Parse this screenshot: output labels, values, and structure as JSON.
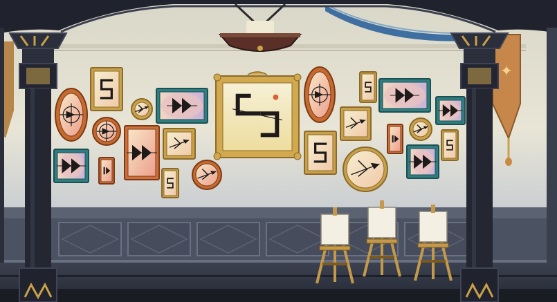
{
  "scene": {
    "wall_color": "#e7e3d3",
    "wainscot_color": "#4b5262",
    "pillar_color": "#232632",
    "gold_color": "#c9a14a",
    "teal_frame_color": "#2f7f82",
    "accent_color": "#e9a07f"
  },
  "frames": [
    {
      "id": "f1",
      "shape": "oval",
      "style": "orange",
      "glyph": "circle-cross"
    },
    {
      "id": "f2",
      "shape": "rect",
      "style": "gold",
      "glyph": "s-rune"
    },
    {
      "id": "f3",
      "shape": "round",
      "style": "gold",
      "glyph": "arrow"
    },
    {
      "id": "f4",
      "shape": "round",
      "style": "orange",
      "glyph": "circle-cross"
    },
    {
      "id": "f5",
      "shape": "rect",
      "style": "teal",
      "glyph": "play-double"
    },
    {
      "id": "f6",
      "shape": "rect",
      "style": "salmon",
      "glyph": "play-double"
    },
    {
      "id": "f7",
      "shape": "rect",
      "style": "gold",
      "glyph": "arrow"
    },
    {
      "id": "f8",
      "shape": "rect",
      "style": "salmon",
      "glyph": "bars"
    },
    {
      "id": "f9",
      "shape": "rect",
      "style": "gold",
      "glyph": "s-rune"
    },
    {
      "id": "f10",
      "shape": "round",
      "style": "orange",
      "glyph": "arrow"
    },
    {
      "id": "f11",
      "shape": "rect",
      "style": "teal",
      "glyph": "play-double"
    },
    {
      "id": "f12",
      "shape": "rect",
      "style": "ornate",
      "glyph": "big-s-rune"
    },
    {
      "id": "f13",
      "shape": "oval",
      "style": "orange",
      "glyph": "circle-cross"
    },
    {
      "id": "f14",
      "shape": "rect",
      "style": "gold",
      "glyph": "arrow"
    },
    {
      "id": "f15",
      "shape": "rect",
      "style": "gold",
      "glyph": "s-rune"
    },
    {
      "id": "f16",
      "shape": "rect",
      "style": "gold",
      "glyph": "s-rune"
    },
    {
      "id": "f17",
      "shape": "round",
      "style": "gold",
      "glyph": "arrow"
    },
    {
      "id": "f18",
      "shape": "rect",
      "style": "teal",
      "glyph": "play-double"
    },
    {
      "id": "f19",
      "shape": "rect",
      "style": "salmon",
      "glyph": "bars"
    },
    {
      "id": "f20",
      "shape": "round",
      "style": "gold",
      "glyph": "arrow"
    },
    {
      "id": "f21",
      "shape": "rect",
      "style": "teal",
      "glyph": "play-double"
    },
    {
      "id": "f22",
      "shape": "rect",
      "style": "gold",
      "glyph": "s-rune"
    },
    {
      "id": "f23",
      "shape": "rect",
      "style": "teal",
      "glyph": "play-double"
    }
  ],
  "easels": [
    {
      "id": "easel-1",
      "canvas": "blank"
    },
    {
      "id": "easel-2",
      "canvas": "blank"
    },
    {
      "id": "easel-3",
      "canvas": "blank"
    }
  ]
}
